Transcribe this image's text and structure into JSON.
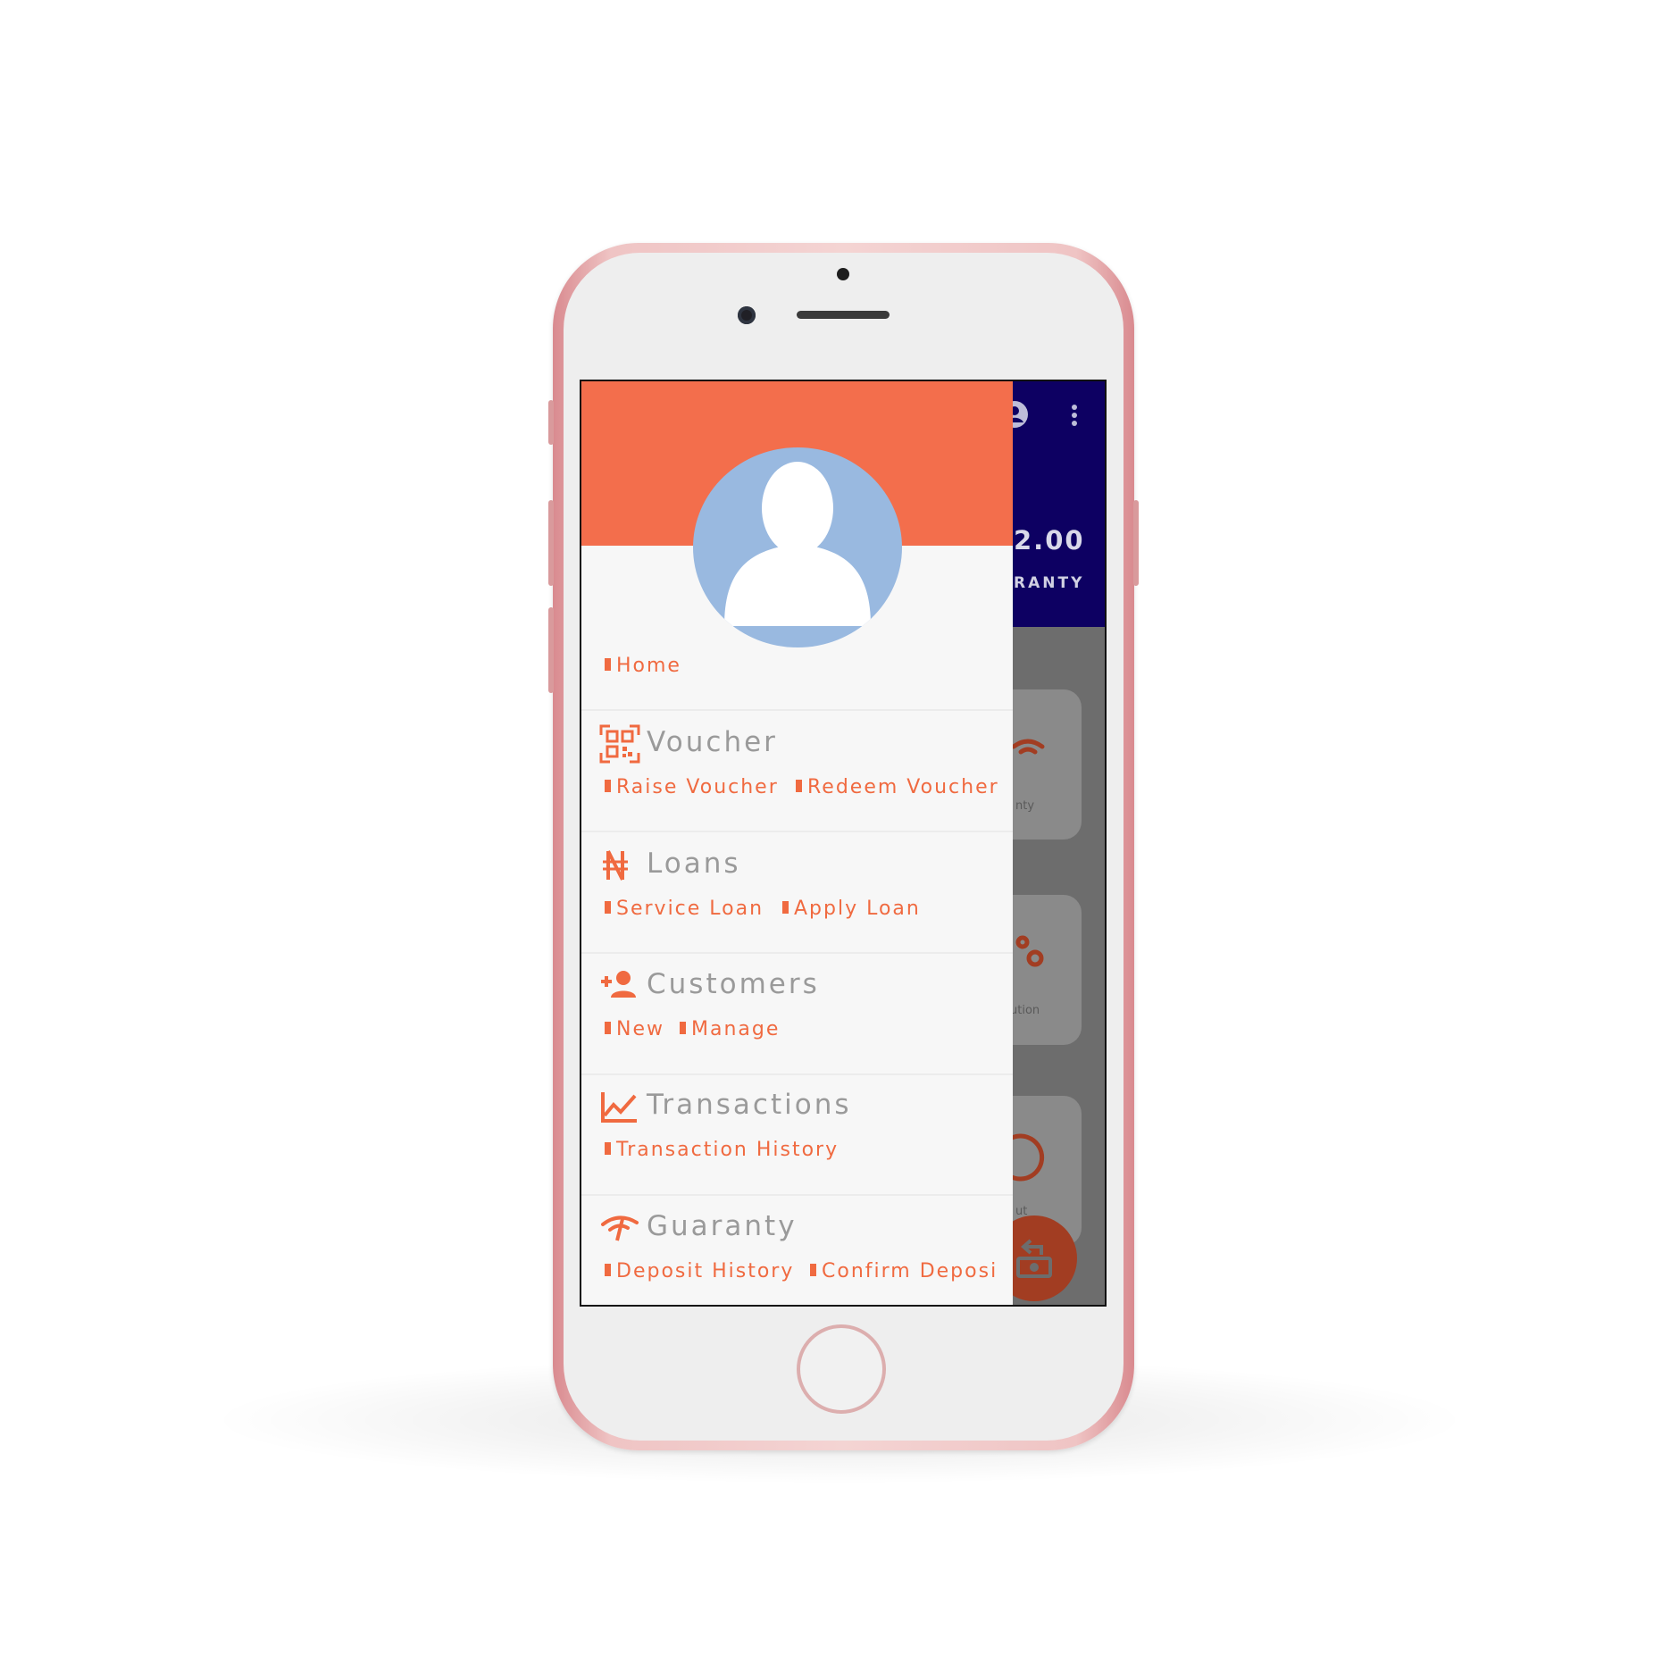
{
  "colors": {
    "accent": "#f36e4c",
    "link": "#f06a40",
    "header_bg": "#0d0062",
    "avatar_bg": "#99b9e0",
    "title_gray": "#9a9a9a"
  },
  "background_app": {
    "amount": "2.00",
    "amount_label": "RANTY",
    "card_labels": [
      "nty",
      "ution",
      "ut"
    ],
    "icons": [
      "account-circle-icon",
      "more-vert-icon",
      "cash-refund-icon"
    ]
  },
  "drawer": {
    "home": {
      "label": "Home"
    },
    "sections": [
      {
        "icon": "qr-code-icon",
        "title": "Voucher",
        "links": [
          "Raise Voucher",
          "Redeem Voucher"
        ]
      },
      {
        "icon": "naira-icon",
        "title": "Loans",
        "links": [
          "Service Loan",
          "Apply Loan"
        ]
      },
      {
        "icon": "add-person-icon",
        "title": "Customers",
        "links": [
          "New",
          "Manage"
        ]
      },
      {
        "icon": "line-chart-icon",
        "title": "Transactions",
        "links": [
          "Transaction History"
        ]
      },
      {
        "icon": "guaranty-icon",
        "title": "Guaranty",
        "links": [
          "Deposit History",
          "Confirm Deposi"
        ]
      }
    ]
  }
}
